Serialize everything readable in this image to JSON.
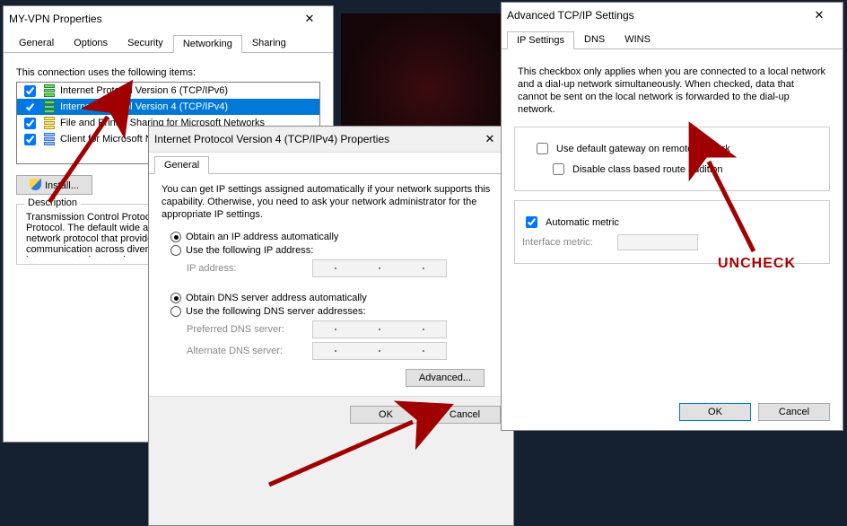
{
  "win1": {
    "title": "MY-VPN Properties",
    "tabs": [
      "General",
      "Options",
      "Security",
      "Networking",
      "Sharing"
    ],
    "active_tab": "Networking",
    "list_label": "This connection uses the following items:",
    "items": [
      {
        "checked": true,
        "label": "Internet Protocol Version 6 (TCP/IPv6)",
        "selected": false
      },
      {
        "checked": true,
        "label": "Internet Protocol Version 4 (TCP/IPv4)",
        "selected": true
      },
      {
        "checked": true,
        "label": "File and Printer Sharing for Microsoft Networks",
        "selected": false
      },
      {
        "checked": true,
        "label": "Client for Microsoft N",
        "selected": false
      }
    ],
    "install_btn": "Install...",
    "desc_legend": "Description",
    "desc_text": "Transmission Control Protocol/Internet Protocol. The default wide area network protocol that provides communication across diverse interconnected networks."
  },
  "win2": {
    "title": "Internet Protocol Version 4 (TCP/IPv4) Properties",
    "tab": "General",
    "intro": "You can get IP settings assigned automatically if your network supports this capability. Otherwise, you need to ask your network administrator for the appropriate IP settings.",
    "r_obtain_ip": "Obtain an IP address automatically",
    "r_use_ip": "Use the following IP address:",
    "ip_label": "IP address:",
    "r_obtain_dns": "Obtain DNS server address automatically",
    "r_use_dns": "Use the following DNS server addresses:",
    "pref_dns": "Preferred DNS server:",
    "alt_dns": "Alternate DNS server:",
    "advanced": "Advanced...",
    "ok": "OK",
    "cancel": "Cancel"
  },
  "win3": {
    "title": "Advanced TCP/IP Settings",
    "tabs": [
      "IP Settings",
      "DNS",
      "WINS"
    ],
    "active_tab": "IP Settings",
    "desc": "This checkbox only applies when you are connected to a local network and a dial-up network simultaneously.  When checked, data that cannot be sent on the local network is forwarded to the dial-up network.",
    "cb_gateway": "Use default gateway on remote network",
    "cb_disable": "Disable class based route addition",
    "cb_automatic": "Automatic metric",
    "interface_metric": "Interface metric:",
    "ok": "OK",
    "cancel": "Cancel",
    "gateway_checked": false,
    "disable_checked": false,
    "automatic_checked": true
  },
  "annotation": {
    "uncheck": "UNCHECK"
  }
}
